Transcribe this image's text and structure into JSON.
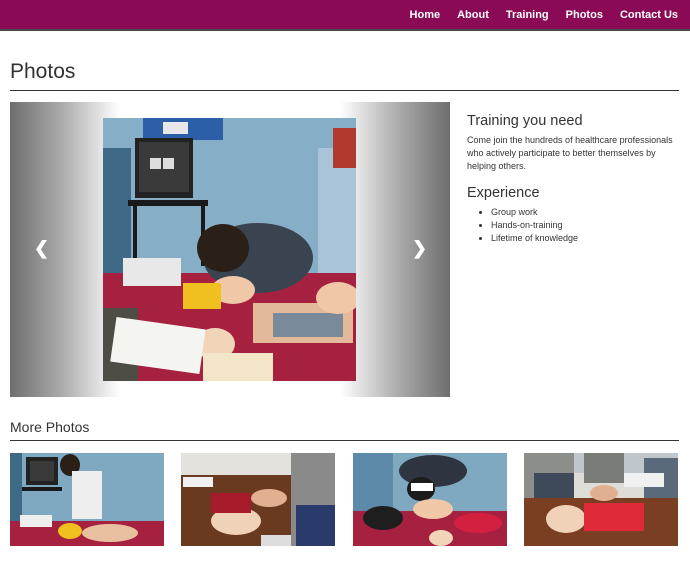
{
  "nav": {
    "items": [
      {
        "label": "Home"
      },
      {
        "label": "About"
      },
      {
        "label": "Training"
      },
      {
        "label": "Photos"
      },
      {
        "label": "Contact Us"
      }
    ]
  },
  "page": {
    "title": "Photos"
  },
  "carousel": {
    "prev_icon": "chevron-left-icon",
    "next_icon": "chevron-right-icon",
    "prev_glyph": "❮",
    "next_glyph": "❯"
  },
  "sidebar": {
    "training_heading": "Training you need",
    "training_text": "Come join the hundreds of healthcare professionals who actively participate to better themselves by helping others.",
    "experience_heading": "Experience",
    "experience_items": [
      "Group work",
      "Hands-on-training",
      "Lifetime of knowledge"
    ]
  },
  "more_photos": {
    "title": "More Photos"
  },
  "colors": {
    "navbar": "#8a0a55",
    "text": "#333333"
  }
}
